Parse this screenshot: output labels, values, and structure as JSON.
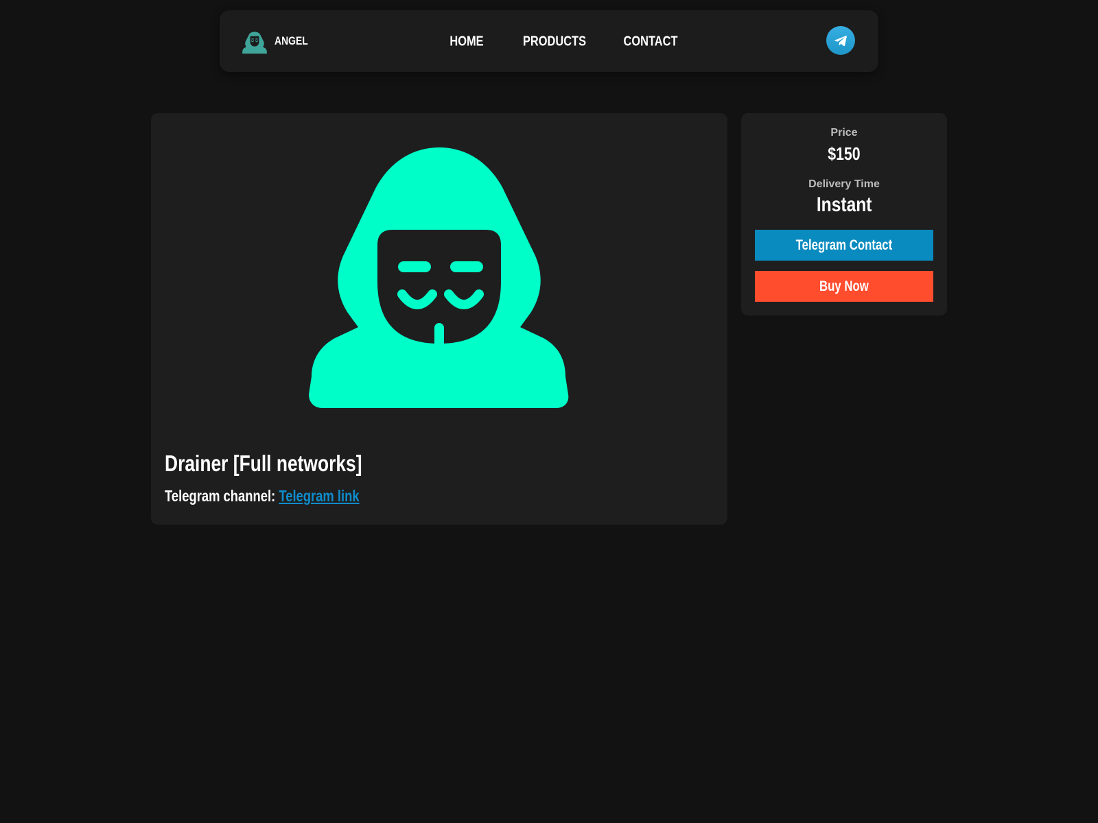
{
  "nav": {
    "brand": "ANGEL",
    "links": [
      "HOME",
      "PRODUCTS",
      "CONTACT"
    ]
  },
  "product": {
    "title": "Drainer [Full networks]",
    "channel_label": "Telegram channel:",
    "channel_link_text": "Telegram link"
  },
  "sidebar": {
    "price_label": "Price",
    "price_value": "$150",
    "delivery_label": "Delivery Time",
    "delivery_value": "Instant",
    "telegram_button": "Telegram Contact",
    "buy_button": "Buy Now"
  },
  "colors": {
    "background": "#121212",
    "card": "#1e1e1e",
    "accent_mint": "#00ffc8",
    "telegram_blue": "#0a8bbf",
    "buy_orange": "#ff4d2e",
    "brand_icon_teal": "#3fa59a"
  },
  "icons": {
    "brand": "hacker-mask-icon",
    "navbar_action": "telegram-icon",
    "hero": "anonymous-hacker-icon"
  }
}
